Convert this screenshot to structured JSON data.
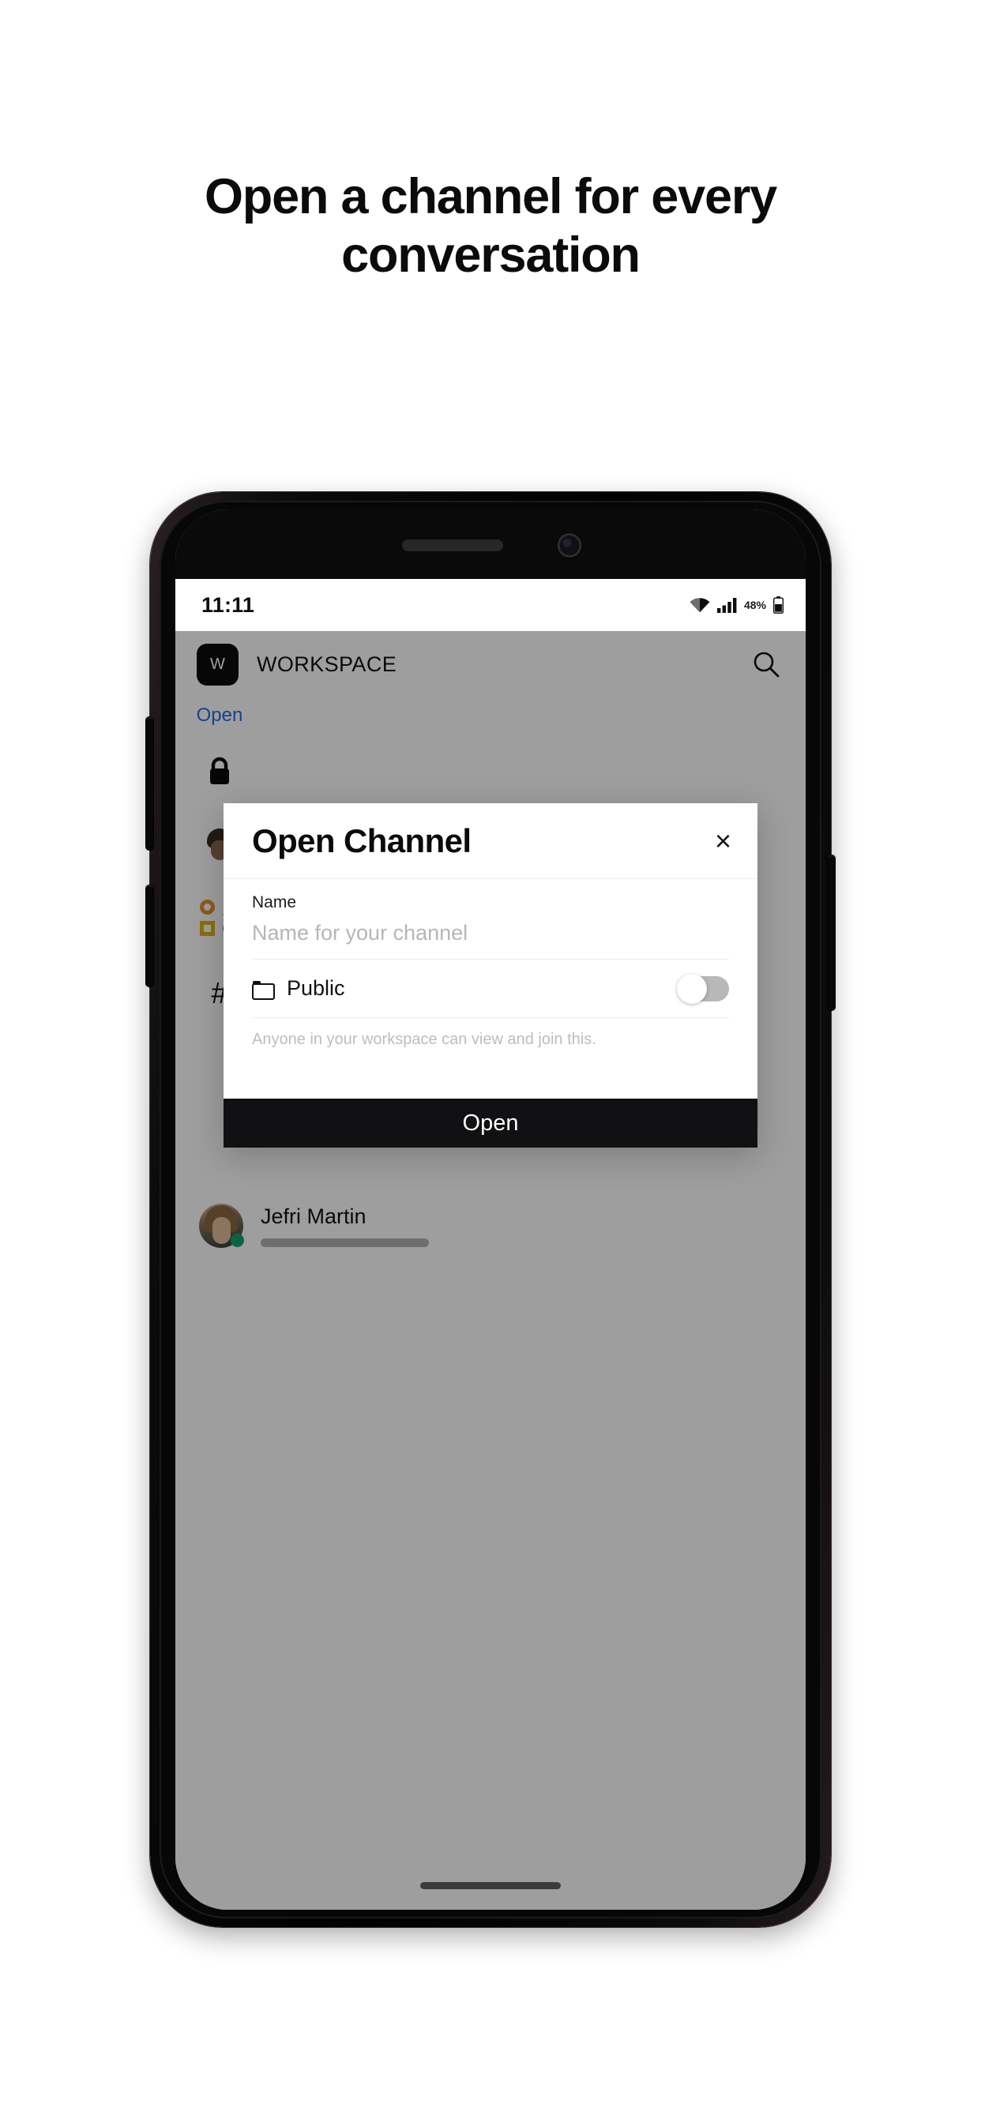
{
  "headline": "Open a channel for every conversation",
  "phone": {
    "status_bar": {
      "time": "11:11",
      "battery_percent": "48%",
      "wifi_icon": "wifi-icon",
      "signal_icon": "cellular-signal-icon",
      "battery_icon": "battery-icon"
    },
    "home_indicator": "home-indicator"
  },
  "app": {
    "header": {
      "workspace_initial": "W",
      "workspace_title": "WORKSPACE",
      "search_icon": "search-icon"
    },
    "rail": {
      "open_link": "Open",
      "items": [
        {
          "icon": "lock-icon",
          "label": ""
        },
        {
          "icon": "avatar-icon",
          "label": ""
        },
        {
          "icon": "shapes-icon",
          "label": ""
        },
        {
          "icon": "hash-icon",
          "label": "#"
        }
      ]
    },
    "dm": {
      "name": "Jefri Martin",
      "status": "online"
    }
  },
  "modal": {
    "title": "Open Channel",
    "close_label": "×",
    "name_label": "Name",
    "name_value": "",
    "name_placeholder": "Name for your channel",
    "visibility_label": "Public",
    "visibility_icon": "folder-icon",
    "visibility_toggle_on": false,
    "help_text": "Anyone in your workspace can view and join this.",
    "primary_button": "Open"
  },
  "colors": {
    "page_background": "#ffffff",
    "headline": "#0b0b0b",
    "accent_link": "#1f6fe0",
    "cta_background": "#111114",
    "cta_text": "#ffffff",
    "scrim": "rgba(0,0,0,0.38)",
    "online_dot": "#16a06a",
    "shape_orange": "#e8902a",
    "shape_green": "#14a05a",
    "shape_yellow": "#e2b410",
    "shape_blue": "#1a6fc4"
  }
}
